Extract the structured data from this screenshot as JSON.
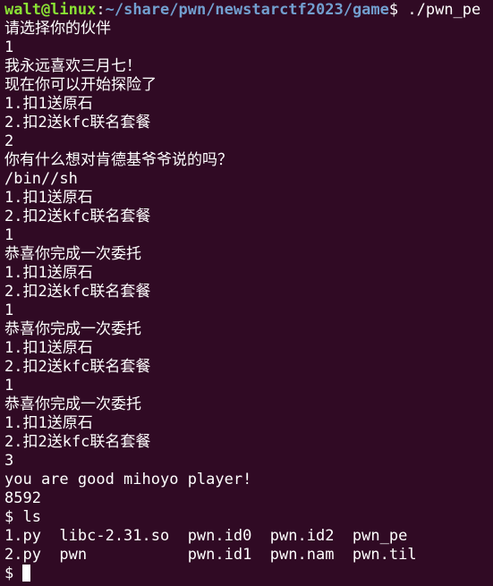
{
  "prompt": {
    "user_host": "walt@linux",
    "colon": ":",
    "path": "~/share/pwn/newstarctf2023/game",
    "dollar": "$ ",
    "command": "./pwn_pe"
  },
  "output_lines": [
    "请选择你的伙伴",
    "1",
    "我永远喜欢三月七！",
    "现在你可以开始探险了",
    "1.扣1送原石",
    "2.扣2送kfc联名套餐",
    "2",
    "你有什么想对肯德基爷爷说的吗？",
    "/bin//sh",
    "1.扣1送原石",
    "2.扣2送kfc联名套餐",
    "1",
    "恭喜你完成一次委托",
    "1.扣1送原石",
    "2.扣2送kfc联名套餐",
    "1",
    "恭喜你完成一次委托",
    "1.扣1送原石",
    "2.扣2送kfc联名套餐",
    "1",
    "恭喜你完成一次委托",
    "1.扣1送原石",
    "2.扣2送kfc联名套餐",
    "3",
    "you are good mihoyo player!",
    "8592",
    "$ ls",
    "1.py  libc-2.31.so  pwn.id0  pwn.id2  pwn_pe",
    "2.py  pwn           pwn.id1  pwn.nam  pwn.til"
  ],
  "final_prompt": "$ ",
  "colors": {
    "background": "#300a24",
    "text": "#ffffff",
    "user_host": "#8ae234",
    "path": "#729fcf"
  }
}
